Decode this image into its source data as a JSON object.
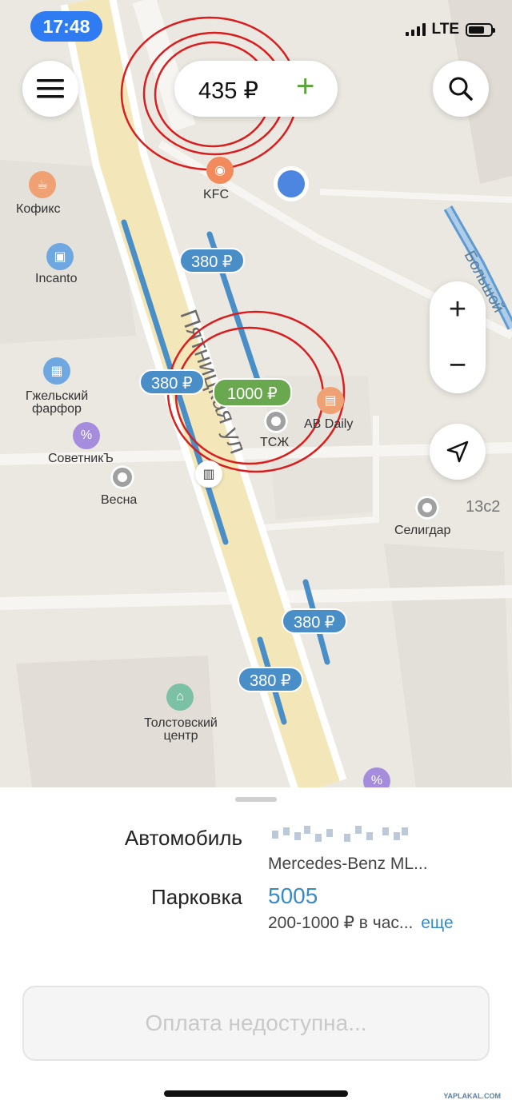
{
  "status_bar": {
    "time": "17:48",
    "network": "LTE"
  },
  "balance": {
    "amount": "435 ₽",
    "add_label": "+"
  },
  "zoom": {
    "in_label": "+",
    "out_label": "−"
  },
  "map": {
    "street_labels": [
      "Пятницкая ул",
      "Большой"
    ],
    "pois": [
      {
        "name": "KFC"
      },
      {
        "name": "Кофикс"
      },
      {
        "name": "Incanto"
      },
      {
        "name": "Гжельский фарфор"
      },
      {
        "name": "СоветникЪ"
      },
      {
        "name": "Весна"
      },
      {
        "name": "AB Daily"
      },
      {
        "name": "ТСЖ"
      },
      {
        "name": "Селигдар"
      },
      {
        "name": "13с2"
      },
      {
        "name": "Толстовский центр"
      }
    ],
    "prices": [
      {
        "label": "380 ₽",
        "color": "#4a8ec7"
      },
      {
        "label": "380 ₽",
        "color": "#4a8ec7"
      },
      {
        "label": "1000 ₽",
        "color": "#6aa84f"
      },
      {
        "label": "380 ₽",
        "color": "#4a8ec7"
      },
      {
        "label": "380 ₽",
        "color": "#4a8ec7"
      }
    ]
  },
  "sheet": {
    "car_label": "Автомобиль",
    "car_model": "Mercedes-Benz ML...",
    "parking_label": "Парковка",
    "parking_number": "5005",
    "rate_text": "200-1000 ₽ в час...",
    "more_link": "еще",
    "pay_button": "Оплата недоступна..."
  },
  "watermark": "YAPLAKAL.COM",
  "colors": {
    "accent": "#2f7cf2",
    "link": "#3a8ac4",
    "price_blue": "#4a8ec7",
    "price_green": "#6aa84f",
    "annotation_red": "#d81e1e"
  }
}
